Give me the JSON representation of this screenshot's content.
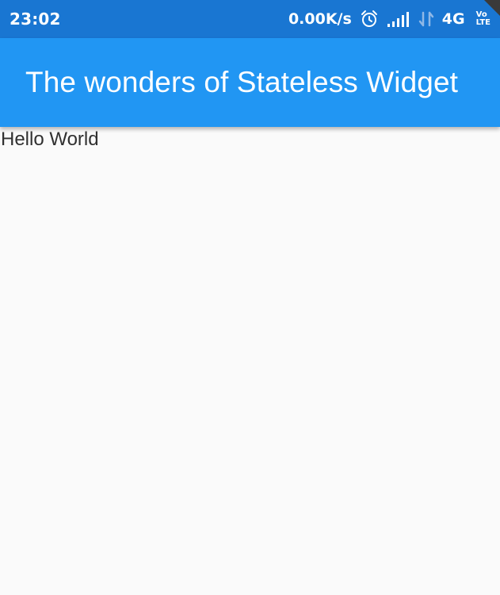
{
  "status_bar": {
    "time": "23:02",
    "net_speed": "0.00K/s",
    "network_type": "4G",
    "volte_top": "Vo",
    "volte_bottom": "LTE",
    "icons": [
      "alarm-icon",
      "signal-icon",
      "data-arrows-icon",
      "volte-icon"
    ]
  },
  "app_bar": {
    "title": "The wonders of Stateless Widget",
    "color": "#2196f3"
  },
  "body": {
    "text": "Hello World"
  },
  "colors": {
    "status_bar": "#1976d2",
    "background": "#fafafa"
  }
}
